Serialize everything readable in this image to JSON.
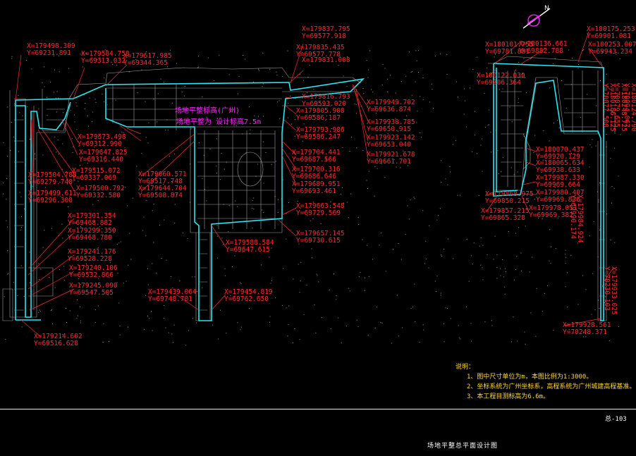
{
  "drawing": {
    "title": "场地平整总平面设计图",
    "number": "总-103",
    "colors": {
      "background": "#000000",
      "boundary": "#29e6ef",
      "coordinates": "#ff2a2a",
      "notes": "#ffd83a",
      "magenta_text": "#ff2aff",
      "structure": "#c8c8c8"
    }
  },
  "notes": {
    "title": "说明：",
    "items": [
      "1、图中尺寸单位为m，本图比例为1:3000。",
      "2、坐标系统为广州坐标系，高程系统为广州城建高程基准。",
      "3、本工程目测标高为6.6m。"
    ]
  },
  "magenta_labels": [
    "场地平整标高(广州)",
    "场地平整为 设计标高7.5m"
  ],
  "north_arrow": {
    "label": "N"
  },
  "coordinates": [
    {
      "x": "X=179498.309",
      "y": "Y=69231.891"
    },
    {
      "x": "X=179584.758",
      "y": "Y=69313.032"
    },
    {
      "x": "X=179617.985",
      "y": "Y=69344.365"
    },
    {
      "x": "X=179837.795",
      "y": "Y=69577.918"
    },
    {
      "x": "X=179835.435",
      "y": "Y=69577.778"
    },
    {
      "x": "X=179831.008",
      "y": ""
    },
    {
      "x": "X=179816.793",
      "y": "Y=69593.020"
    },
    {
      "x": "X=179805.908",
      "y": "Y=69586.187"
    },
    {
      "x": "X=179793.986",
      "y": "Y=69586.247"
    },
    {
      "x": "X=179949.702",
      "y": "Y=69636.874"
    },
    {
      "x": "X=179938.785",
      "y": "Y=69650.915"
    },
    {
      "x": "X=179923.142",
      "y": "Y=69653.040"
    },
    {
      "x": "X=179921.678",
      "y": "Y=69661.701"
    },
    {
      "x": "X=179573.498",
      "y": "Y=69312.990"
    },
    {
      "x": "X=179647.825",
      "y": "Y=69316.440"
    },
    {
      "x": "X=179515.072",
      "y": "Y=69337.069"
    },
    {
      "x": "X=179504.788",
      "y": "Y=69279.748"
    },
    {
      "x": "X=179500.792",
      "y": "Y=69332.580"
    },
    {
      "x": "X=179499.611",
      "y": "Y=69296.308"
    },
    {
      "x": "X=179660.571",
      "y": "Y=69517.748"
    },
    {
      "x": "X=179644.704",
      "y": "Y=69508.874"
    },
    {
      "x": "X=179704.441",
      "y": "Y=69687.566"
    },
    {
      "x": "X=179700.316",
      "y": "Y=69686.646"
    },
    {
      "x": "X=179689.951",
      "y": "Y=69693.461"
    },
    {
      "x": "X=179663.548",
      "y": "Y=69729.569"
    },
    {
      "x": "X=179657.145",
      "y": "Y=69730.615"
    },
    {
      "x": "X=179588.584",
      "y": "Y=69647.615"
    },
    {
      "x": "X=179301.354",
      "y": "Y=69468.882"
    },
    {
      "x": "X=179299.350",
      "y": "Y=69468.780"
    },
    {
      "x": "X=179241.176",
      "y": "Y=69528.228"
    },
    {
      "x": "X=179240.106",
      "y": "Y=69532.866"
    },
    {
      "x": "X=179245.090",
      "y": "Y=69547.505"
    },
    {
      "x": "X=179214.602",
      "y": "Y=69516.628"
    },
    {
      "x": "X=179439.064",
      "y": "Y=69748.701"
    },
    {
      "x": "X=179454.819",
      "y": "Y=69762.650"
    },
    {
      "x": "X=180101.755",
      "y": "Y=69781.881"
    },
    {
      "x": "X=180136.661",
      "y": "Y=69882.788"
    },
    {
      "x": "X=180175.253",
      "y": "Y=69901.081"
    },
    {
      "x": "X=180253.007",
      "y": "Y=69943.234"
    },
    {
      "x": "X=180122.030",
      "y": "Y=69806.364"
    },
    {
      "x": "X=180070.437",
      "y": "Y=69920.129"
    },
    {
      "x": "X=180065.634",
      "y": "Y=69938.633"
    },
    {
      "x": "X=179987.330",
      "y": "Y=69969.664"
    },
    {
      "x": "X=179980.407",
      "y": "Y=69969.836"
    },
    {
      "x": "X=179978.051",
      "y": "Y=69969.382"
    },
    {
      "x": "X=179868.975",
      "y": "Y=69850.215"
    },
    {
      "x": "X=179857.215",
      "y": "Y=69865.328"
    },
    {
      "x": "X=179928.561",
      "y": "Y=70248.371"
    },
    {
      "x": "X=180186.125",
      "y": "Y=70077.508"
    },
    {
      "x": "X=180248.725",
      "y": "Y=70079.655"
    },
    {
      "x": "X=180124.790",
      "y": "Y=70094.067"
    },
    {
      "x": "X=179933.025",
      "y": "Y=70230.103"
    },
    {
      "x": "X=179984.924",
      "y": "Y=69990.174"
    }
  ]
}
